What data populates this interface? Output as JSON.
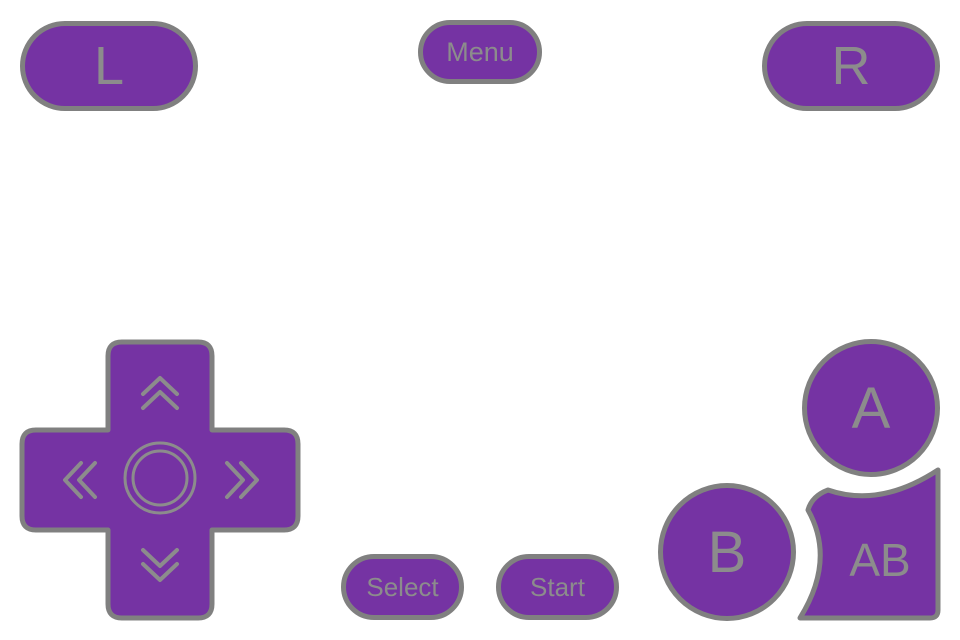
{
  "controller": {
    "colors": {
      "button_fill": "#7533a3",
      "button_border": "#808080",
      "label_color": "#8c8c8c",
      "background": "#ffffff"
    },
    "shoulder": {
      "left_label": "L",
      "right_label": "R"
    },
    "menu_label": "Menu",
    "select_label": "Select",
    "start_label": "Start",
    "face": {
      "a_label": "A",
      "b_label": "B",
      "ab_label": "AB"
    },
    "dpad": {
      "up_icon": "chevron-double-up-icon",
      "down_icon": "chevron-double-down-icon",
      "left_icon": "chevron-double-left-icon",
      "right_icon": "chevron-double-right-icon",
      "center_icon": "ring-icon"
    }
  }
}
